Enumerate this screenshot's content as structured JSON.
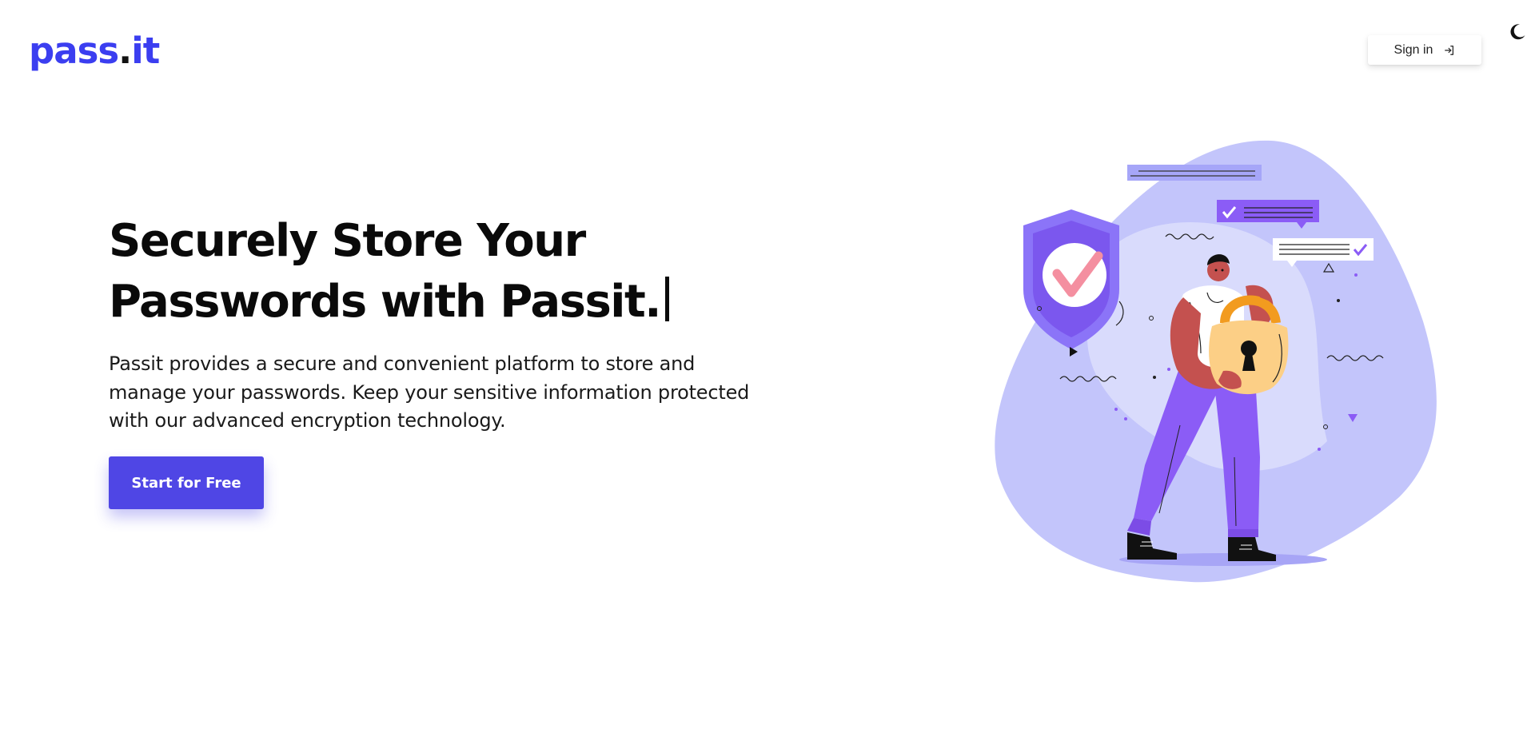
{
  "header": {
    "logo_main": "pass",
    "logo_dot": ".",
    "logo_tail": "it",
    "signin_label": "Sign in"
  },
  "hero": {
    "headline_line1": "Securely Store Your",
    "headline_line2": "Passwords with Passit.",
    "description": "Passit provides a secure and convenient platform to store and manage your passwords. Keep your sensitive information protected with our advanced encryption technology.",
    "cta_label": "Start for Free"
  },
  "icons": {
    "theme": "moon-icon",
    "signin": "sign-in-icon"
  },
  "colors": {
    "brand": "#3b3ef0",
    "button": "#4f46e5",
    "blob": "#c2c5fb",
    "purple": "#8b5cf6"
  }
}
